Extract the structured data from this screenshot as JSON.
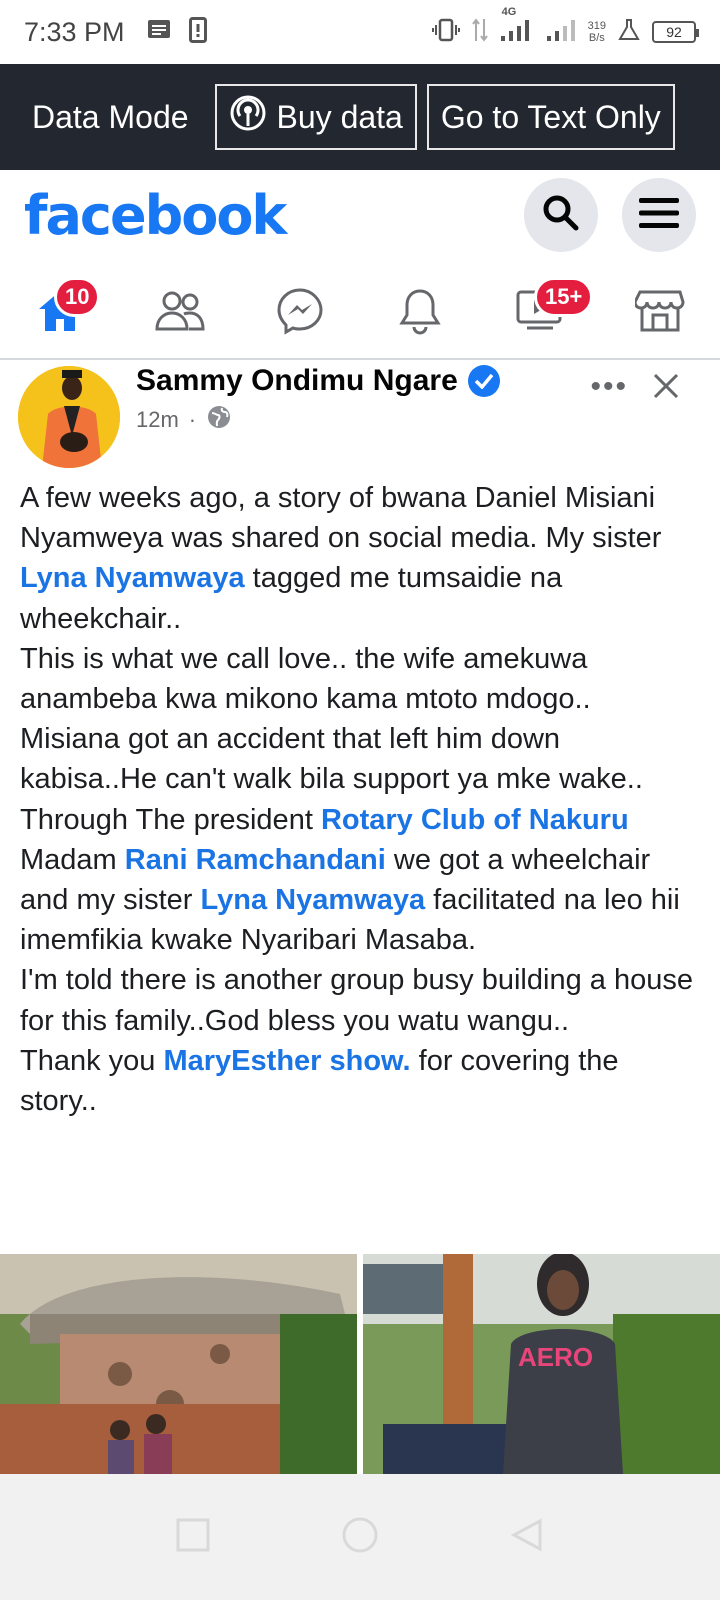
{
  "status_bar": {
    "time": "7:33 PM",
    "network_type": "4G",
    "net_speed_value": "319",
    "net_speed_unit": "B/s",
    "battery": "92"
  },
  "data_bar": {
    "mode_label": "Data Mode",
    "buy_data_label": "Buy data",
    "text_only_label": "Go to Text Only"
  },
  "header": {
    "logo": "facebook"
  },
  "nav": {
    "home_badge": "10",
    "video_badge": "15+"
  },
  "post": {
    "author": "Sammy Ondimu Ngare",
    "time": "12m",
    "separator": "·",
    "body": {
      "p1_a": "A few weeks ago, a story of bwana Daniel Misiani Nyamweya was shared on social media. My sister ",
      "tag_lyna_1": "Lyna Nyamwaya",
      "p1_b": " tagged me tumsaidie na wheekchair..",
      "p2": "This is what we call love.. the wife amekuwa anambeba kwa mikono kama mtoto mdogo..",
      "p3": "Misiana got an accident that left him down kabisa..He can't walk bila support ya mke wake..",
      "p4_a": "Through The president ",
      "tag_rotary": "Rotary Club of Nakuru",
      "p4_b": " Madam ",
      "tag_rani": "Rani Ramchandani",
      "p4_c": " we got a wheelchair and my sister ",
      "tag_lyna_2": "Lyna Nyamwaya",
      "p4_d": " facilitated na leo hii imemfikia kwake Nyaribari Masaba.",
      "p5": "I'm told there is another group busy building a house for this family..God bless you watu wangu..",
      "p6_a": "Thank you ",
      "tag_maryesther": "MaryEsther show.",
      "p6_b": " for covering the story.."
    },
    "photo_hoodie_text": "AERO"
  },
  "colors": {
    "brand": "#1877f2",
    "tag": "#1b74e4",
    "badge": "#e41e3f",
    "data_bar_bg": "#232830"
  }
}
